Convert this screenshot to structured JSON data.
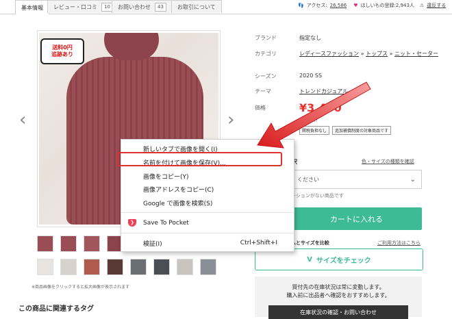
{
  "tabs": [
    {
      "label": "基本情報",
      "count": ""
    },
    {
      "label": "レビュー・口コミ",
      "count": "10"
    },
    {
      "label": "お問い合わせ",
      "count": "43"
    },
    {
      "label": "お取引について",
      "count": ""
    }
  ],
  "meta": {
    "access_label": "アクセス:",
    "access_count": "26,586",
    "wishlist_text": "ほしいもの登録:2,943人",
    "report_link": "違反する"
  },
  "photo": {
    "shipping_badge_line1": "送料0円",
    "shipping_badge_line2": "追跡あり"
  },
  "specs": {
    "brand_label": "ブランド",
    "brand_value": "指定なし",
    "category_label": "カテゴリ",
    "category_1": "レディースファッション",
    "category_2": "トップス",
    "category_3": "ニット・セーター",
    "season_label": "シーズン",
    "season_value": "2020 SS",
    "theme_label": "テーマ",
    "theme_value": "トレンドカジュアル",
    "price_label": "価格",
    "price_value": "¥3,400",
    "price_note": "(送料込)",
    "chip_1": "関税負担なし",
    "chip_2": "追加補償制度の対象商品です"
  },
  "purchase": {
    "select_label": "択",
    "size_guide_link": "色・サイズの種類を確認",
    "select_placeholder": "ください",
    "no_variation_note": "ーションがない商品です",
    "cart_button": "カートに入れる",
    "size_compare_label": "ムとサイズを比較",
    "usage_link": "ご利用方法はこちら",
    "size_check_button": "サイズをチェック",
    "stock_line1": "買付先の在庫状況は常に変動します。",
    "stock_line2": "購入前に出品者へ確認をおすすめします。",
    "stock_button": "在庫状況の確認・お問い合わせ"
  },
  "thumbnails_note": "※商品画像をクリックすると拡大画像が表示されます",
  "related_tags_heading": "この商品に関連するタグ",
  "context_menu": {
    "items": [
      "新しいタブで画像を開く(I)",
      "名前を付けて画像を保存(V)...",
      "画像をコピー(Y)",
      "画像アドレスをコピー(C)",
      "Google で画像を検索(S)",
      "Save To Pocket",
      "検証(I)"
    ],
    "inspect_shortcut": "Ctrl+Shift+I"
  },
  "colors": {
    "accent_green": "#3dbb95",
    "price_red": "#e8302d",
    "highlight_red": "#e0302c",
    "pocket_red": "#ef4056"
  }
}
